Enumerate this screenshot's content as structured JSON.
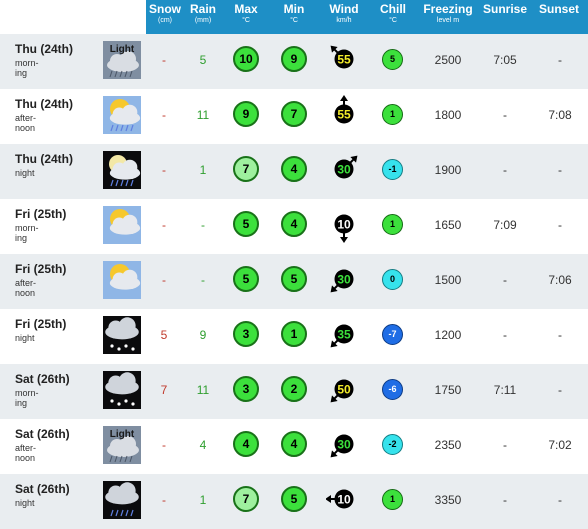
{
  "header": {
    "snow": {
      "label": "Snow",
      "unit": "(cm)"
    },
    "rain": {
      "label": "Rain",
      "unit": "(mm)"
    },
    "max": {
      "label": "Max",
      "unit": "°C"
    },
    "min": {
      "label": "Min",
      "unit": "°C"
    },
    "wind": {
      "label": "Wind",
      "unit": "km/h"
    },
    "chill": {
      "label": "Chill",
      "unit": "°C"
    },
    "freezing": {
      "label": "Freezing",
      "unit": "level m"
    },
    "sunrise": {
      "label": "Sunrise"
    },
    "sunset": {
      "label": "Sunset"
    }
  },
  "rows": [
    {
      "day": "Thu (24th)",
      "period": "morn-\ning",
      "icon": "light-snow-cloud-icon",
      "icon_text": "Light",
      "snow": "-",
      "rain": "5",
      "max": "10",
      "min": "9",
      "wind": "55",
      "wind_dir": "up-left",
      "chill": "5",
      "chill_color": "green",
      "freezing": "2500",
      "sunrise": "7:05",
      "sunset": "-"
    },
    {
      "day": "Thu (24th)",
      "period": "after-\nnoon",
      "icon": "sun-cloud-rain-icon",
      "icon_text": "",
      "snow": "-",
      "rain": "11",
      "max": "9",
      "min": "7",
      "wind": "55",
      "wind_dir": "up",
      "chill": "1",
      "chill_color": "green",
      "freezing": "1800",
      "sunrise": "-",
      "sunset": "7:08"
    },
    {
      "day": "Thu (24th)",
      "period": "night",
      "icon": "moon-cloud-rain-icon",
      "icon_text": "",
      "snow": "-",
      "rain": "1",
      "max": "7",
      "min": "4",
      "wind": "30",
      "wind_dir": "up-right",
      "chill": "-1",
      "chill_color": "cyan",
      "freezing": "1900",
      "sunrise": "-",
      "sunset": "-"
    },
    {
      "day": "Fri (25th)",
      "period": "morn-\ning",
      "icon": "sun-cloud-icon",
      "icon_text": "",
      "snow": "-",
      "rain": "-",
      "max": "5",
      "min": "4",
      "wind": "10",
      "wind_dir": "down",
      "chill": "1",
      "chill_color": "green",
      "freezing": "1650",
      "sunrise": "7:09",
      "sunset": "-"
    },
    {
      "day": "Fri (25th)",
      "period": "after-\nnoon",
      "icon": "sun-cloud-icon",
      "icon_text": "",
      "snow": "-",
      "rain": "-",
      "max": "5",
      "min": "5",
      "wind": "30",
      "wind_dir": "down-left",
      "chill": "0",
      "chill_color": "cyan",
      "freezing": "1500",
      "sunrise": "-",
      "sunset": "7:06"
    },
    {
      "day": "Fri (25th)",
      "period": "night",
      "icon": "night-cloud-snow-icon",
      "icon_text": "",
      "snow": "5",
      "rain": "9",
      "max": "3",
      "min": "1",
      "wind": "35",
      "wind_dir": "down-left",
      "chill": "-7",
      "chill_color": "blue",
      "freezing": "1200",
      "sunrise": "-",
      "sunset": "-"
    },
    {
      "day": "Sat (26th)",
      "period": "morn-\ning",
      "icon": "cloud-snow-icon",
      "icon_text": "",
      "snow": "7",
      "rain": "11",
      "max": "3",
      "min": "2",
      "wind": "50",
      "wind_dir": "down-left",
      "chill": "-6",
      "chill_color": "blue",
      "freezing": "1750",
      "sunrise": "7:11",
      "sunset": "-"
    },
    {
      "day": "Sat (26th)",
      "period": "after-\nnoon",
      "icon": "light-snow-cloud-icon",
      "icon_text": "Light",
      "snow": "-",
      "rain": "4",
      "max": "4",
      "min": "4",
      "wind": "30",
      "wind_dir": "down-left",
      "chill": "-2",
      "chill_color": "cyan",
      "freezing": "2350",
      "sunrise": "-",
      "sunset": "7:02"
    },
    {
      "day": "Sat (26th)",
      "period": "night",
      "icon": "night-cloud-rain-icon",
      "icon_text": "",
      "snow": "-",
      "rain": "1",
      "max": "7",
      "min": "5",
      "wind": "10",
      "wind_dir": "left",
      "chill": "1",
      "chill_color": "green",
      "freezing": "3350",
      "sunrise": "-",
      "sunset": "-"
    }
  ],
  "colors": {
    "header_bg": "#1e8fc6",
    "alt_row_bg": "#e9edf0",
    "temp_green": "#3ce03c",
    "chill_cyan": "#36e2ec",
    "chill_blue": "#1f6de5",
    "snow_red": "#c0392b",
    "rain_green": "#2e9e2e"
  }
}
